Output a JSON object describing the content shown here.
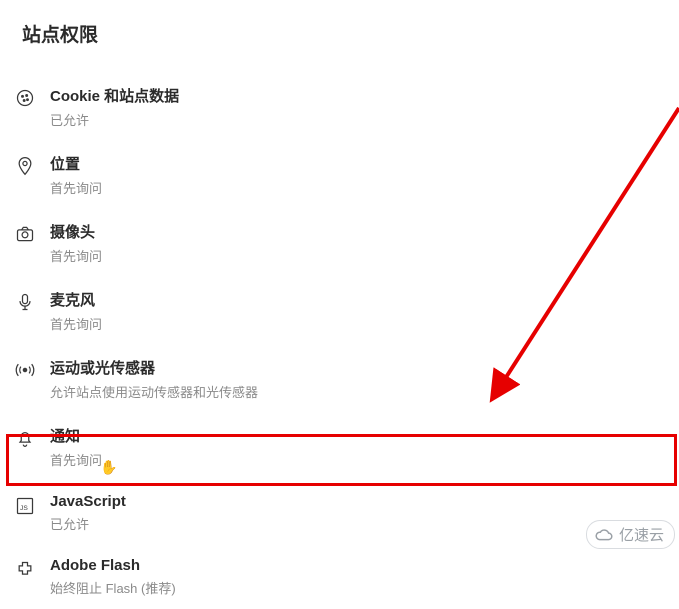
{
  "page_title": "站点权限",
  "permissions": [
    {
      "key": "cookies",
      "label": "Cookie 和站点数据",
      "status": "已允许"
    },
    {
      "key": "location",
      "label": "位置",
      "status": "首先询问"
    },
    {
      "key": "camera",
      "label": "摄像头",
      "status": "首先询问"
    },
    {
      "key": "microphone",
      "label": "麦克风",
      "status": "首先询问"
    },
    {
      "key": "motion",
      "label": "运动或光传感器",
      "status": "允许站点使用运动传感器和光传感器"
    },
    {
      "key": "notify",
      "label": "通知",
      "status": "首先询问"
    },
    {
      "key": "javascript",
      "label": "JavaScript",
      "status": "已允许"
    },
    {
      "key": "flash",
      "label": "Adobe Flash",
      "status": "始终阻止 Flash (推荐)"
    }
  ],
  "watermark_text": "亿速云",
  "annotation": {
    "arrow_color": "#e60000",
    "highlighted_item": "javascript"
  }
}
